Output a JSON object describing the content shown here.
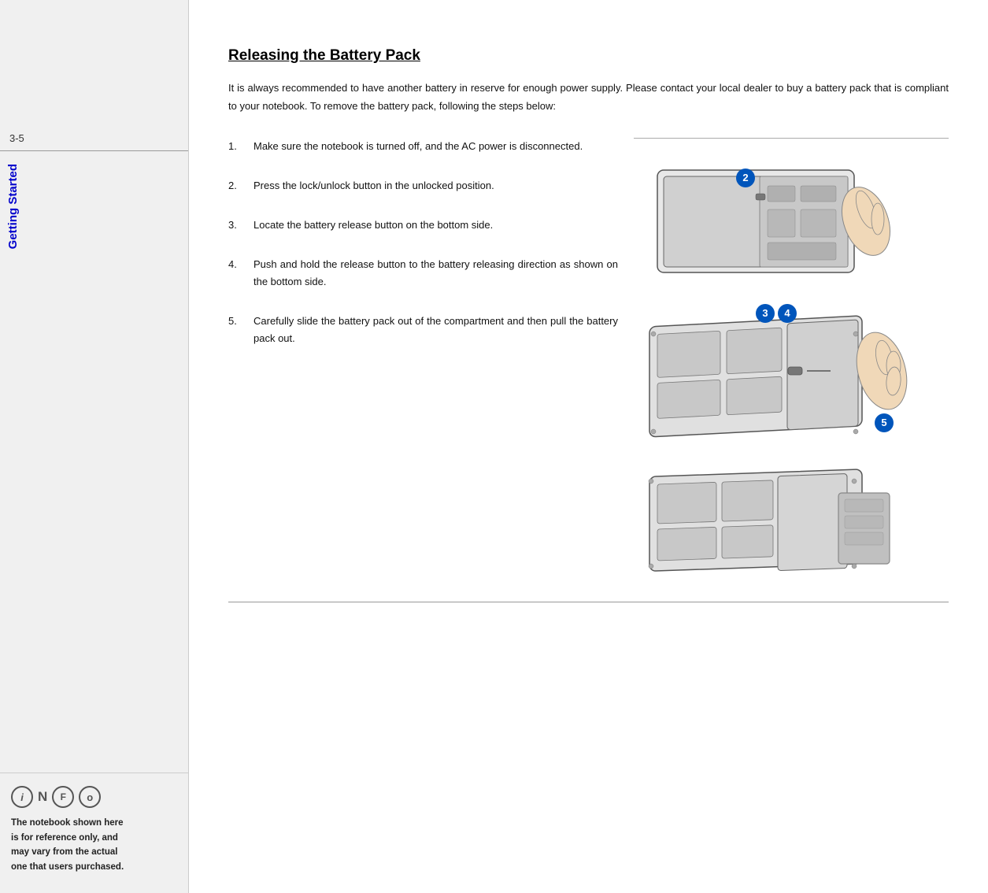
{
  "sidebar": {
    "page_number": "3-5",
    "chapter_label": "Getting Started",
    "info_icons": [
      "i",
      "N",
      "F",
      "o"
    ],
    "note_text": "The notebook shown here is for reference only, and may vary from the actual one that users purchased."
  },
  "main": {
    "section_title": "Releasing the Battery Pack",
    "intro_text": "It is always recommended to have another  battery in reserve for enough power supply.  Please contact your local dealer  to buy a battery pack that is  compliant  to your notebook.   To remove the battery pack, following the steps below:",
    "steps": [
      {
        "number": "1.",
        "text": "Make sure the notebook is turned off,  and  the  AC  power  is disconnected."
      },
      {
        "number": "2.",
        "text": "Press  the  lock/unlock  button  in the unlocked position."
      },
      {
        "number": "3.",
        "text": "Locate the  battery release button on the bottom side."
      },
      {
        "number": "4.",
        "text": "Push and hold the release button to the  battery releasing  direction as shown on the bottom side."
      },
      {
        "number": "5.",
        "text": "Carefully  slide  the  battery  pack out  of  the compartment  and then pull the battery pack out."
      }
    ],
    "diagram_badges": {
      "badge2": "2",
      "badge3": "3",
      "badge4": "4",
      "badge5": "5"
    }
  }
}
